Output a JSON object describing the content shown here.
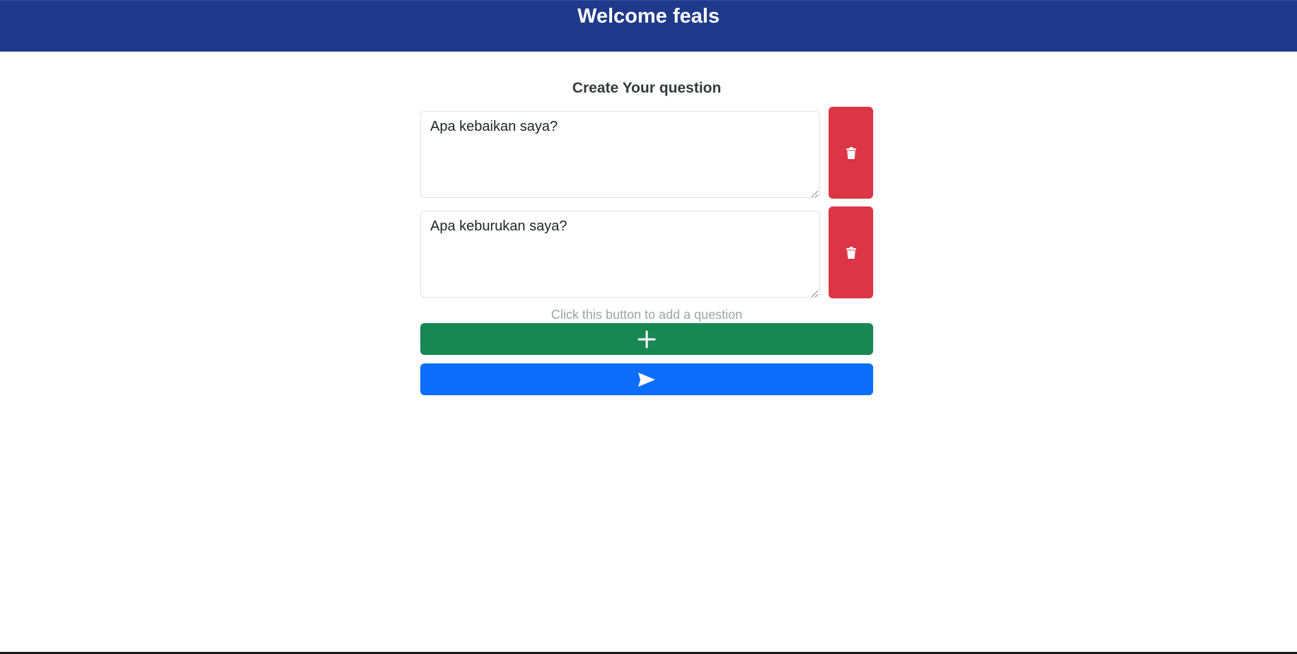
{
  "header": {
    "title": "Welcome feals",
    "color": "#1f3a8a"
  },
  "form": {
    "title": "Create Your question",
    "questions": [
      {
        "value": "Apa kebaikan saya?"
      },
      {
        "value": "Apa keburukan saya?"
      }
    ],
    "hint": "Click this button to add a question"
  },
  "icons": {
    "delete": "trash-icon",
    "add": "plus-icon",
    "send": "send-icon"
  },
  "colors": {
    "delete": "#dc3545",
    "add": "#198754",
    "send": "#0d6efd"
  }
}
